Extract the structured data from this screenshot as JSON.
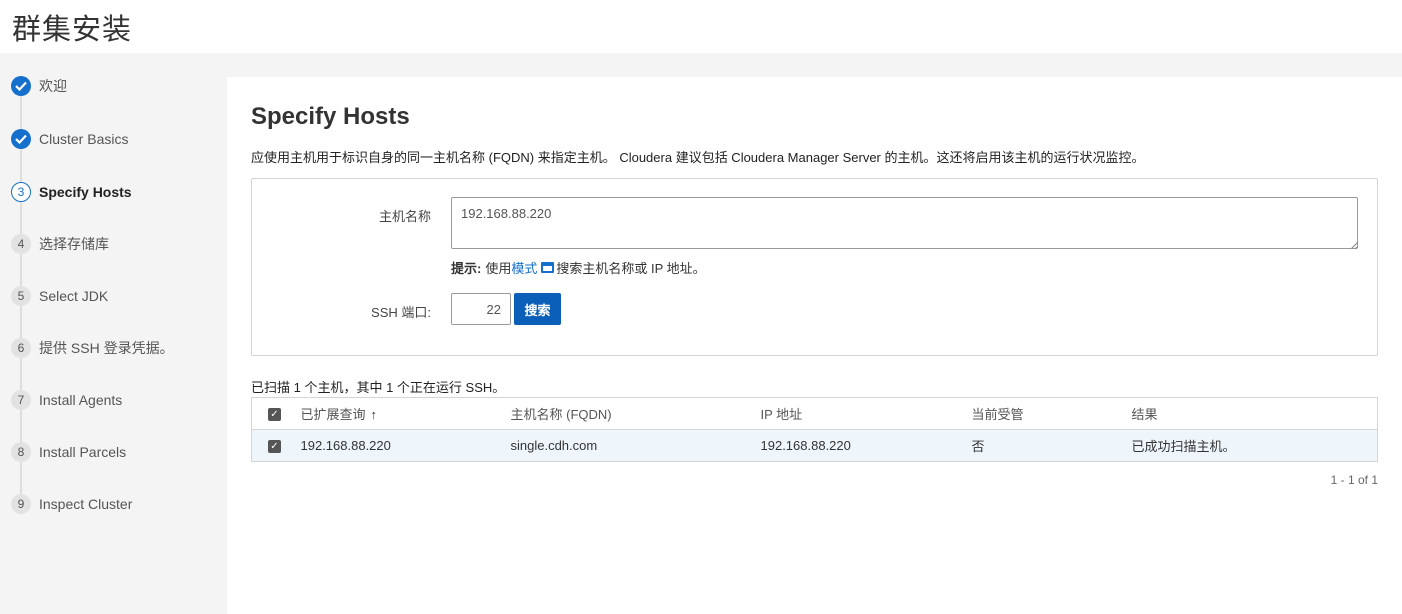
{
  "app": {
    "title": "群集安装"
  },
  "steps": [
    {
      "num": "1",
      "label": "欢迎",
      "state": "done"
    },
    {
      "num": "2",
      "label": "Cluster Basics",
      "state": "done"
    },
    {
      "num": "3",
      "label": "Specify Hosts",
      "state": "current"
    },
    {
      "num": "4",
      "label": "选择存储库",
      "state": "todo"
    },
    {
      "num": "5",
      "label": "Select JDK",
      "state": "todo"
    },
    {
      "num": "6",
      "label": "提供 SSH 登录凭据。",
      "state": "todo"
    },
    {
      "num": "7",
      "label": "Install Agents",
      "state": "todo"
    },
    {
      "num": "8",
      "label": "Install Parcels",
      "state": "todo"
    },
    {
      "num": "9",
      "label": "Inspect Cluster",
      "state": "todo"
    }
  ],
  "page": {
    "title": "Specify Hosts",
    "description": "应使用主机用于标识自身的同一主机名称 (FQDN) 来指定主机。 Cloudera 建议包括 Cloudera Manager Server 的主机。这还将启用该主机的运行状况监控。"
  },
  "form": {
    "hostname_label": "主机名称",
    "hostname_value": "192.168.88.220",
    "hint_prefix": "提示:",
    "hint_use": "使用",
    "hint_link": "模式",
    "hint_suffix": "搜索主机名称或 IP 地址。",
    "ssh_port_label": "SSH 端口:",
    "ssh_port_value": "22",
    "search_button": "搜索"
  },
  "scan_summary": "已扫描 1 个主机，其中 1 个正在运行 SSH。",
  "table": {
    "columns": [
      "已扩展查询",
      "主机名称 (FQDN)",
      "IP 地址",
      "当前受管",
      "结果"
    ],
    "rows": [
      {
        "expanded_query": "192.168.88.220",
        "fqdn": "single.cdh.com",
        "ip": "192.168.88.220",
        "managed": "否",
        "result": "已成功扫描主机。",
        "checked": true
      }
    ]
  },
  "pagination": "1 - 1 of 1",
  "colors": {
    "accent": "#1470cc",
    "button": "#0c5fb8",
    "row_highlight": "#eef6fc"
  }
}
